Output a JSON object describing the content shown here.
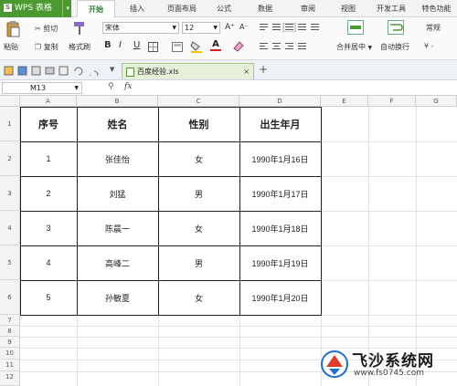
{
  "app": {
    "name": "WPS 表格",
    "menu_arrow": "▾"
  },
  "tabs": [
    {
      "label": "开始",
      "active": true
    },
    {
      "label": "插入",
      "active": false
    },
    {
      "label": "页面布局",
      "active": false
    },
    {
      "label": "公式",
      "active": false
    },
    {
      "label": "数据",
      "active": false
    },
    {
      "label": "审阅",
      "active": false
    },
    {
      "label": "视图",
      "active": false
    },
    {
      "label": "开发工具",
      "active": false
    },
    {
      "label": "特色功能",
      "active": false
    }
  ],
  "ribbon": {
    "paste": "粘贴",
    "cut": "剪切",
    "copy": "复制",
    "format_painter": "格式刷",
    "font_name": "宋体",
    "font_size": "12",
    "bold": "B",
    "italic": "I",
    "underline": "U",
    "grow_font": "A⁺",
    "shrink_font": "A⁻",
    "merge_center": "合并居中",
    "wrap_text": "自动换行",
    "number_format": "常规"
  },
  "document": {
    "tab_name": "百度经验.xls",
    "close": "×",
    "add": "+"
  },
  "formula_bar": {
    "cell_ref": "M13",
    "fx": "fx",
    "value": ""
  },
  "columns": [
    "A",
    "B",
    "C",
    "D",
    "E",
    "F",
    "G"
  ],
  "rows": [
    "1",
    "2",
    "3",
    "4",
    "5",
    "6",
    "7",
    "8",
    "9",
    "10",
    "11",
    "12"
  ],
  "table": {
    "headers": [
      "序号",
      "姓名",
      "性别",
      "出生年月"
    ],
    "rows": [
      [
        "1",
        "张佳怡",
        "女",
        "1990年1月16日"
      ],
      [
        "2",
        "刘猛",
        "男",
        "1990年1月17日"
      ],
      [
        "3",
        "陈晨一",
        "女",
        "1990年1月18日"
      ],
      [
        "4",
        "高峰二",
        "男",
        "1990年1月19日"
      ],
      [
        "5",
        "孙敏夏",
        "女",
        "1990年1月20日"
      ]
    ]
  },
  "watermark": {
    "title": "飞沙系统网",
    "url": "www.fs0745.com"
  },
  "colors": {
    "wps_green": "#4a9a2f",
    "active_tab_text": "#2e7d32",
    "watermark_red": "#e03a2a",
    "watermark_blue": "#1d6fd6"
  }
}
